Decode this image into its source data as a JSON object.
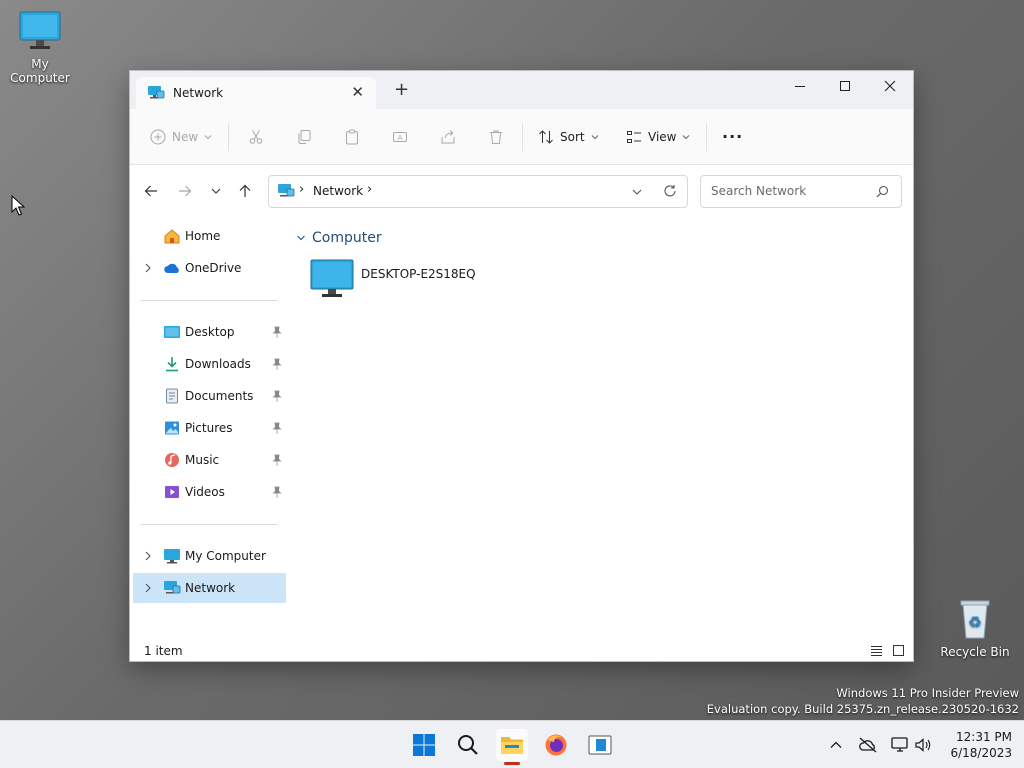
{
  "desktop": {
    "icons": [
      {
        "label": "My Computer"
      },
      {
        "label": "Recycle Bin"
      }
    ],
    "watermark": {
      "line1": "Windows 11 Pro Insider Preview",
      "line2": "Evaluation copy. Build 25375.zn_release.230520-1632"
    }
  },
  "window": {
    "tab_title": "Network",
    "tab_close": "✕",
    "new_tab": "+",
    "toolbar": {
      "new_label": "New",
      "sort_label": "Sort",
      "view_label": "View",
      "more_label": "···"
    },
    "address": {
      "segments": [
        "Network"
      ],
      "separator": "›"
    },
    "search": {
      "placeholder": "Search Network"
    },
    "sidebar": {
      "top": [
        {
          "label": "Home",
          "icon": "home-icon"
        },
        {
          "label": "OneDrive",
          "icon": "cloud-icon"
        }
      ],
      "quick_access": [
        {
          "label": "Desktop",
          "icon": "desktop-folder-icon"
        },
        {
          "label": "Downloads",
          "icon": "download-icon"
        },
        {
          "label": "Documents",
          "icon": "documents-icon"
        },
        {
          "label": "Pictures",
          "icon": "pictures-icon"
        },
        {
          "label": "Music",
          "icon": "music-icon"
        },
        {
          "label": "Videos",
          "icon": "videos-icon"
        }
      ],
      "bottom": [
        {
          "label": "My Computer",
          "icon": "computer-icon"
        },
        {
          "label": "Network",
          "icon": "network-icon",
          "selected": true
        }
      ]
    },
    "content": {
      "group_label": "Computer",
      "items": [
        {
          "name": "DESKTOP-E2S18EQ"
        }
      ]
    },
    "status": {
      "item_count": "1 item"
    }
  },
  "taskbar": {
    "time": "12:31 PM",
    "date": "6/18/2023"
  },
  "colors": {
    "accent": "#0067c0",
    "selection": "#cce4f7",
    "monitor": "#2ba6dc"
  }
}
